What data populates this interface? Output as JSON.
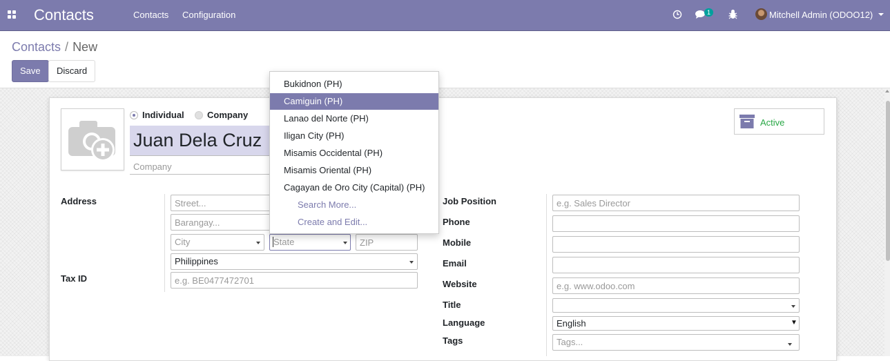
{
  "navbar": {
    "app_title": "Contacts",
    "menu": [
      "Contacts",
      "Configuration"
    ],
    "messages_badge": "1",
    "user_name": "Mitchell Admin (ODOO12)",
    "icons": [
      "apps-icon",
      "clock-icon",
      "chat-icon",
      "bug-icon",
      "avatar"
    ],
    "color": "#7c7bad"
  },
  "breadcrumb": {
    "parent": "Contacts",
    "separator": "/",
    "current": "New"
  },
  "buttons": {
    "save": "Save",
    "discard": "Discard"
  },
  "form": {
    "type_options": [
      "Individual",
      "Company"
    ],
    "type_selected": "Individual",
    "name": "Juan Dela Cruz",
    "company_placeholder": "Company",
    "active_label": "Active",
    "labels": {
      "address": "Address",
      "tax_id": "Tax ID",
      "job_position": "Job Position",
      "phone": "Phone",
      "mobile": "Mobile",
      "email": "Email",
      "website": "Website",
      "title": "Title",
      "language": "Language",
      "tags": "Tags"
    },
    "placeholders": {
      "street": "Street...",
      "barangay": "Barangay...",
      "city": "City",
      "state": "State",
      "zip": "ZIP",
      "tax_id": "e.g. BE0477472701",
      "job_position": "e.g. Sales Director",
      "website": "e.g. www.odoo.com",
      "tags": "Tags..."
    },
    "values": {
      "country": "Philippines",
      "language": "English"
    }
  },
  "state_dropdown": {
    "items": [
      "Bukidnon (PH)",
      "Camiguin (PH)",
      "Lanao del Norte (PH)",
      "Iligan City (PH)",
      "Misamis Occidental (PH)",
      "Misamis Oriental (PH)",
      "Cagayan de Oro City (Capital) (PH)"
    ],
    "highlighted": "Camiguin (PH)",
    "actions": [
      "Search More...",
      "Create and Edit..."
    ]
  }
}
